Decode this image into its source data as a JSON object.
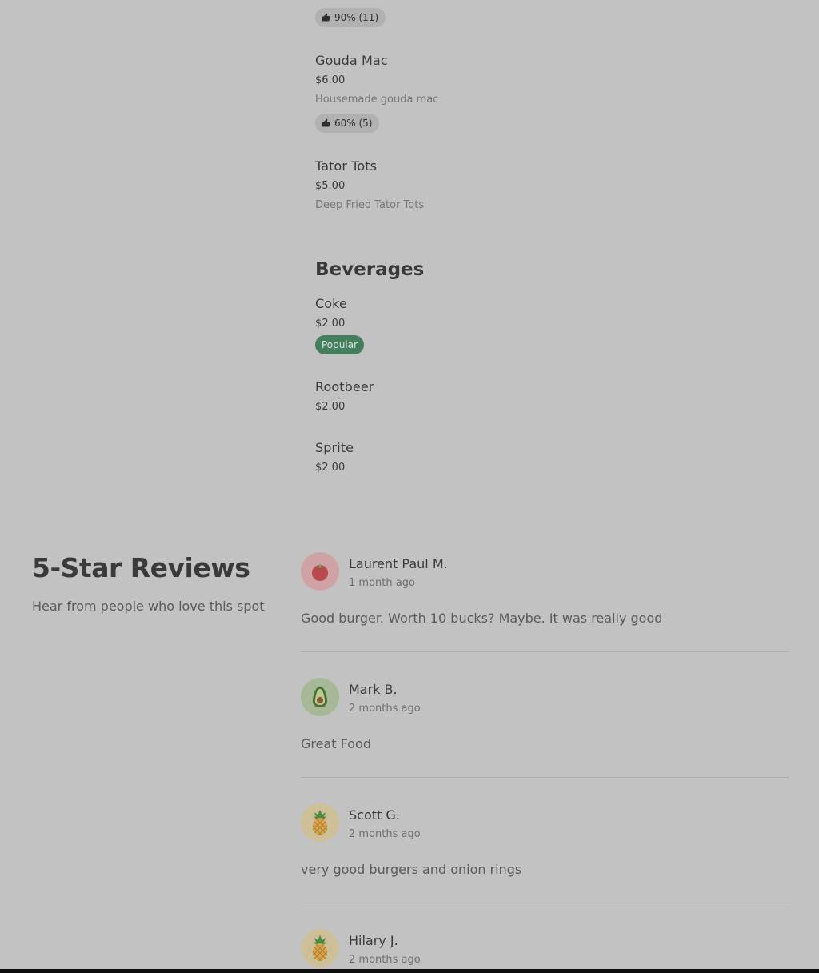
{
  "menu": {
    "top_rating": "90% (11)",
    "items": [
      {
        "name": "Gouda Mac",
        "price": "$6.00",
        "description": "Housemade gouda mac",
        "rating": "60% (5)"
      },
      {
        "name": "Tator Tots",
        "price": "$5.00",
        "description": "Deep Fried Tator Tots"
      }
    ],
    "beverages": {
      "title": "Beverages",
      "items": [
        {
          "name": "Coke",
          "price": "$2.00",
          "badge": "Popular"
        },
        {
          "name": "Rootbeer",
          "price": "$2.00"
        },
        {
          "name": "Sprite",
          "price": "$2.00"
        }
      ]
    }
  },
  "reviews": {
    "title": "5-Star Reviews",
    "subtitle": "Hear from people who love this spot",
    "items": [
      {
        "name": "Laurent Paul M.",
        "date": "1 month ago",
        "text": "Good burger. Worth 10 bucks? Maybe. It was really good",
        "avatar_icon": "tomato-icon"
      },
      {
        "name": "Mark B.",
        "date": "2 months ago",
        "text": "Great Food",
        "avatar_icon": "avocado-icon"
      },
      {
        "name": "Scott G.",
        "date": "2 months ago",
        "text": "very good burgers and onion rings",
        "avatar_icon": "pineapple-icon"
      },
      {
        "name": "Hilary J.",
        "date": "2 months ago",
        "avatar_icon": "pineapple-icon"
      }
    ]
  },
  "colors": {
    "background": "#c2c2c2",
    "popular_badge": "#457d5f",
    "rating_badge": "#b1b1b1",
    "text": "#3a3a3a"
  }
}
